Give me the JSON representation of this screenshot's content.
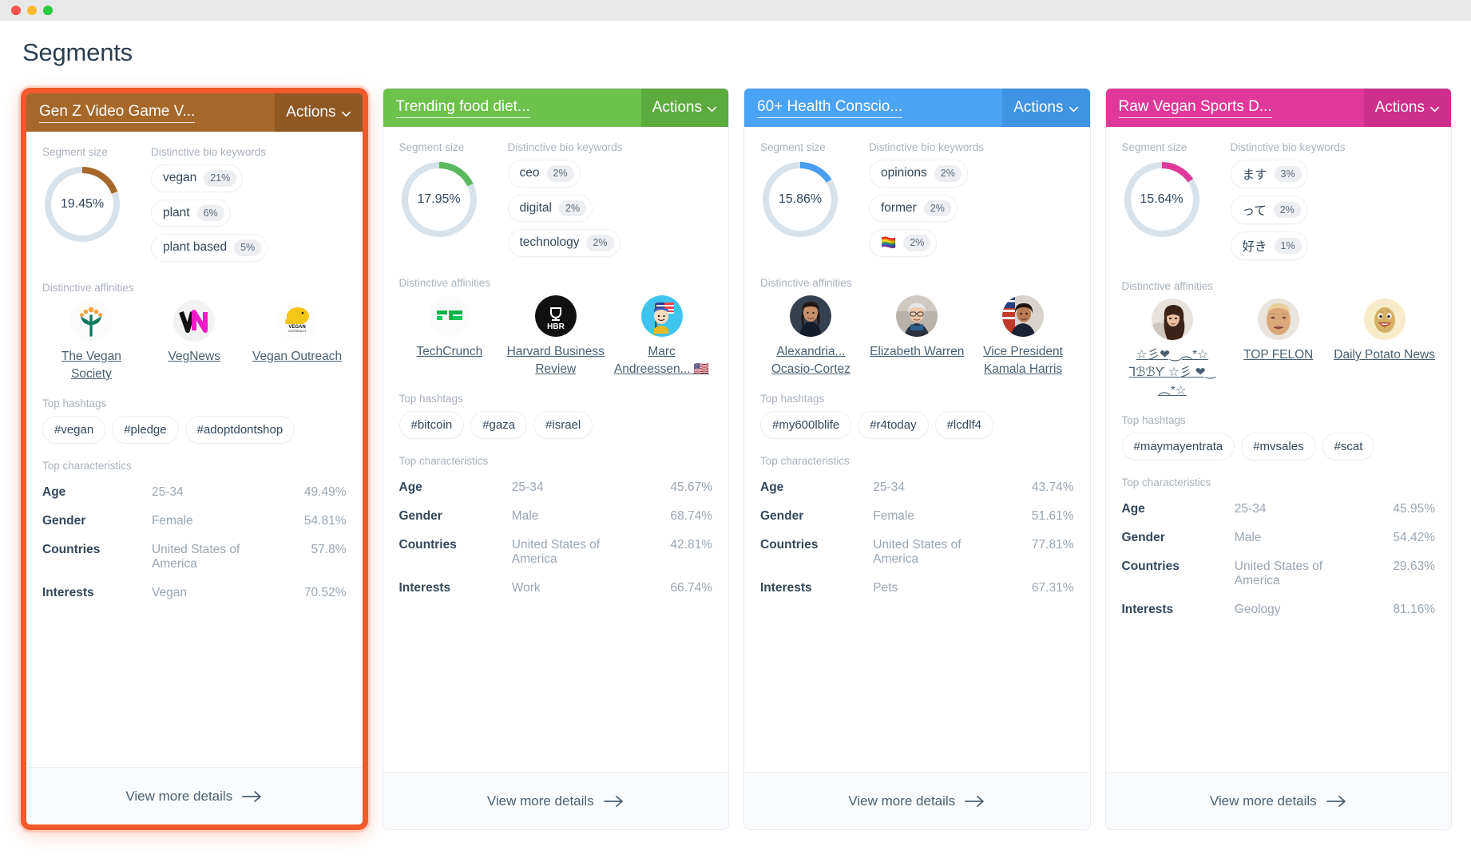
{
  "window": {
    "traffic_lights": [
      "close-red",
      "minimize-yellow",
      "maximize-green"
    ],
    "page_title": "Segments"
  },
  "labels": {
    "segment_size": "Segment size",
    "bio_keywords": "Distinctive bio keywords",
    "affinities": "Distinctive affinities",
    "hashtags": "Top hashtags",
    "characteristics": "Top characteristics",
    "actions": "Actions",
    "view_more": "View more details"
  },
  "chart_data": {
    "type": "pie",
    "title": "Segment size donut gauges",
    "series": [
      {
        "name": "Gen Z Video Game V...",
        "value": 19.45,
        "label": "19.45%",
        "color": "#a6682a"
      },
      {
        "name": "Trending food diet...",
        "value": 17.95,
        "label": "17.95%",
        "color": "#5cb85c"
      },
      {
        "name": "60+ Health Conscio...",
        "value": 15.86,
        "label": "15.86%",
        "color": "#4a9ef0"
      },
      {
        "name": "Raw Vegan Sports D...",
        "value": 15.64,
        "label": "15.64%",
        "color": "#e0389a"
      }
    ],
    "track_color": "#d8e2ea",
    "max": 100,
    "ylabel": "",
    "xlabel": ""
  },
  "cards": [
    {
      "id": "gen-z-video-game",
      "title": "Gen Z Video Game V...",
      "header_color": "#a6682a",
      "header_actions_color": "#8f5722",
      "accent": "#a6682a",
      "selected": true,
      "selection_color": "#f15a2b",
      "segment_size": "19.45%",
      "segment_size_value": 19.45,
      "keywords": [
        {
          "word": "vegan",
          "pct": "21%"
        },
        {
          "word": "plant",
          "pct": "6%"
        },
        {
          "word": "plant based",
          "pct": "5%"
        }
      ],
      "affinities": [
        {
          "name": "The Vegan Society",
          "icon": "vegan-society-logo"
        },
        {
          "name": "VegNews",
          "icon": "vegnews-logo"
        },
        {
          "name": "Vegan Outreach",
          "icon": "vegan-outreach-logo"
        }
      ],
      "hashtags": [
        "#vegan",
        "#pledge",
        "#adoptdontshop"
      ],
      "characteristics": [
        {
          "key": "Age",
          "value": "25-34",
          "pct": "49.49%"
        },
        {
          "key": "Gender",
          "value": "Female",
          "pct": "54.81%"
        },
        {
          "key": "Countries",
          "value": "United States of America",
          "pct": "57.8%"
        },
        {
          "key": "Interests",
          "value": "Vegan",
          "pct": "70.52%"
        }
      ]
    },
    {
      "id": "trending-food-diet",
      "title": "Trending food diet...",
      "header_color": "#6cc24a",
      "header_actions_color": "#5cab3e",
      "accent": "#5cb85c",
      "selected": false,
      "selection_color": "",
      "segment_size": "17.95%",
      "segment_size_value": 17.95,
      "keywords": [
        {
          "word": "ceo",
          "pct": "2%"
        },
        {
          "word": "digital",
          "pct": "2%"
        },
        {
          "word": "technology",
          "pct": "2%"
        }
      ],
      "affinities": [
        {
          "name": "TechCrunch",
          "icon": "techcrunch-logo"
        },
        {
          "name": "Harvard Business Review",
          "icon": "hbr-logo"
        },
        {
          "name": "Marc Andreessen... 🇺🇸",
          "icon": "marc-andreessen-avatar"
        }
      ],
      "hashtags": [
        "#bitcoin",
        "#gaza",
        "#israel"
      ],
      "characteristics": [
        {
          "key": "Age",
          "value": "25-34",
          "pct": "45.67%"
        },
        {
          "key": "Gender",
          "value": "Male",
          "pct": "68.74%"
        },
        {
          "key": "Countries",
          "value": "United States of America",
          "pct": "42.81%"
        },
        {
          "key": "Interests",
          "value": "Work",
          "pct": "66.74%"
        }
      ]
    },
    {
      "id": "health-conscious-60plus",
      "title": "60+ Health Conscio...",
      "header_color": "#4aa3f5",
      "header_actions_color": "#3e93e3",
      "accent": "#4a9ef0",
      "selected": false,
      "selection_color": "",
      "segment_size": "15.86%",
      "segment_size_value": 15.86,
      "keywords": [
        {
          "word": "opinions",
          "pct": "2%"
        },
        {
          "word": "former",
          "pct": "2%"
        },
        {
          "word": "🏳️‍🌈",
          "pct": "2%"
        }
      ],
      "affinities": [
        {
          "name": "Alexandria... Ocasio-Cortez",
          "icon": "aoc-avatar"
        },
        {
          "name": "Elizabeth Warren",
          "icon": "elizabeth-warren-avatar"
        },
        {
          "name": "Vice President Kamala Harris",
          "icon": "kamala-harris-avatar"
        }
      ],
      "hashtags": [
        "#my600lblife",
        "#r4today",
        "#lcdlf4"
      ],
      "characteristics": [
        {
          "key": "Age",
          "value": "25-34",
          "pct": "43.74%"
        },
        {
          "key": "Gender",
          "value": "Female",
          "pct": "51.61%"
        },
        {
          "key": "Countries",
          "value": "United States of America",
          "pct": "77.81%"
        },
        {
          "key": "Interests",
          "value": "Pets",
          "pct": "67.31%"
        }
      ]
    },
    {
      "id": "raw-vegan-sports",
      "title": "Raw Vegan Sports D...",
      "header_color": "#e0389a",
      "header_actions_color": "#cd2f8b",
      "accent": "#e0389a",
      "selected": false,
      "selection_color": "",
      "segment_size": "15.64%",
      "segment_size_value": 15.64,
      "keywords": [
        {
          "word": "ます",
          "pct": "3%"
        },
        {
          "word": "って",
          "pct": "2%"
        },
        {
          "word": "好き",
          "pct": "1%"
        }
      ],
      "affinities": [
        {
          "name": "☆彡❤︎‿︵*☆ ⅂ℬℬƳ ☆彡 ❤︎‿︵*☆",
          "icon": "abby-avatar"
        },
        {
          "name": "TOP FELON",
          "icon": "top-felon-avatar"
        },
        {
          "name": "Daily Potato News",
          "icon": "daily-potato-news-avatar"
        }
      ],
      "hashtags": [
        "#maymayentrata",
        "#mvsales",
        "#scat"
      ],
      "characteristics": [
        {
          "key": "Age",
          "value": "25-34",
          "pct": "45.95%"
        },
        {
          "key": "Gender",
          "value": "Male",
          "pct": "54.42%"
        },
        {
          "key": "Countries",
          "value": "United States of America",
          "pct": "29.63%"
        },
        {
          "key": "Interests",
          "value": "Geology",
          "pct": "81.16%"
        }
      ]
    }
  ]
}
